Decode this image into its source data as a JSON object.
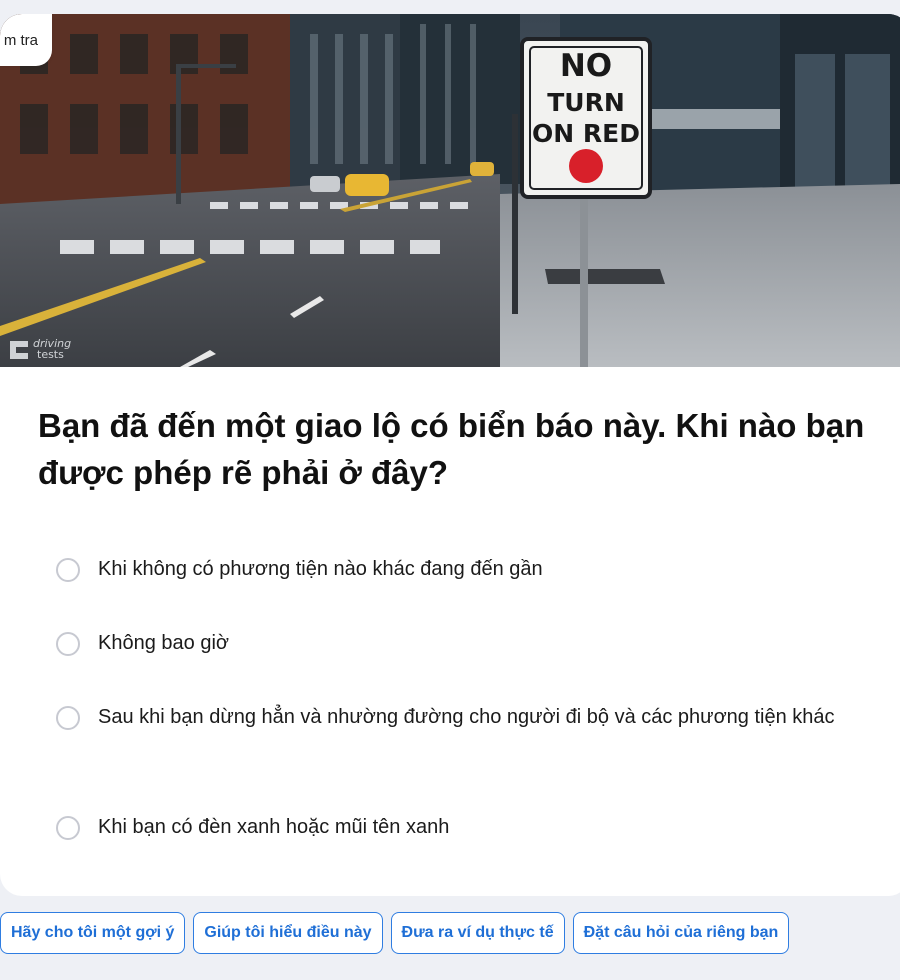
{
  "header": {
    "corner_label": "m tra"
  },
  "scene": {
    "sign_lines": [
      "NO",
      "TURN",
      "ON RED"
    ],
    "watermark_top": "driving",
    "watermark_bottom": "tests",
    "sign_dot_color": "#d8202a"
  },
  "question": {
    "text": "Bạn đã đến một giao lộ có biển báo này. Khi nào bạn được phép rẽ phải ở đây?"
  },
  "options": [
    {
      "label": "Khi không có phương tiện nào khác đang đến gần"
    },
    {
      "label": "Không bao giờ"
    },
    {
      "label": "Sau khi bạn dừng hẳn và nhường đường cho người đi bộ và các phương tiện khác"
    },
    {
      "label": "Khi bạn có đèn xanh hoặc mũi tên xanh"
    }
  ],
  "helpers": [
    {
      "label": "Hãy cho tôi một gợi ý"
    },
    {
      "label": "Giúp tôi hiểu điều này"
    },
    {
      "label": "Đưa ra ví dụ thực tế"
    },
    {
      "label": "Đặt câu hỏi của riêng bạn"
    }
  ],
  "colors": {
    "accent": "#1f6fd6",
    "page_background": "#eef0f5"
  }
}
